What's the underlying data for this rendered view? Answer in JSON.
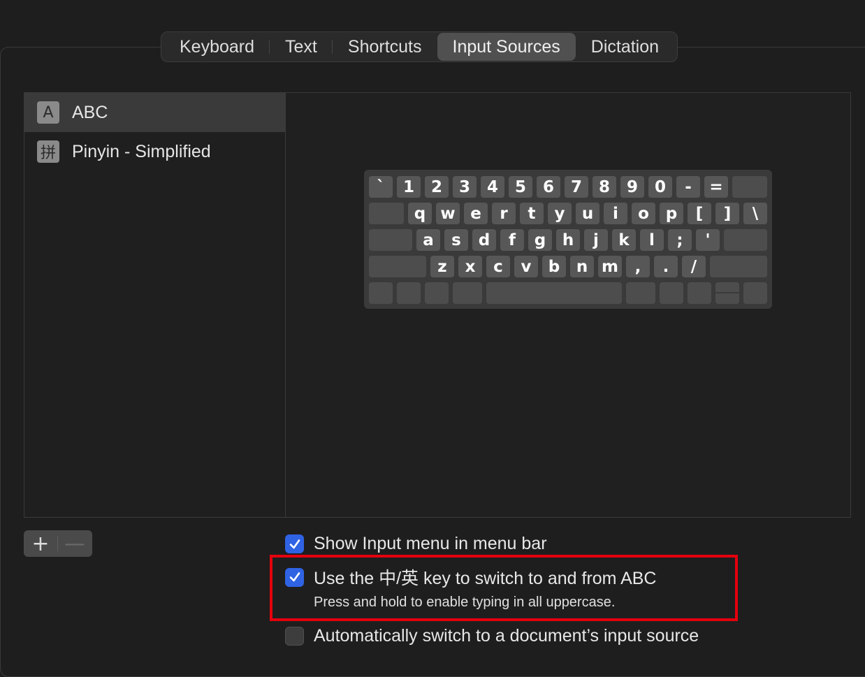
{
  "tabs": [
    "Keyboard",
    "Text",
    "Shortcuts",
    "Input Sources",
    "Dictation"
  ],
  "active_tab": "Input Sources",
  "input_sources": [
    {
      "icon": "A",
      "label": "ABC",
      "selected": true
    },
    {
      "icon": "拼",
      "label": "Pinyin - Simplified",
      "selected": false
    }
  ],
  "keyboard": {
    "row1": [
      "`",
      "1",
      "2",
      "3",
      "4",
      "5",
      "6",
      "7",
      "8",
      "9",
      "0",
      "-",
      "="
    ],
    "row2": [
      "q",
      "w",
      "e",
      "r",
      "t",
      "y",
      "u",
      "i",
      "o",
      "p",
      "[",
      "]",
      "\\"
    ],
    "row3": [
      "a",
      "s",
      "d",
      "f",
      "g",
      "h",
      "j",
      "k",
      "l",
      ";",
      "'"
    ],
    "row4": [
      "z",
      "x",
      "c",
      "v",
      "b",
      "n",
      "m",
      ",",
      ".",
      "/"
    ]
  },
  "buttons": {
    "add": "+",
    "remove": "—"
  },
  "options": {
    "show_input_menu": {
      "label": "Show Input menu in menu bar",
      "checked": true
    },
    "use_key": {
      "label": "Use the 中/英 key to switch to and from ABC",
      "checked": true,
      "sublabel": "Press and hold to enable typing in all uppercase."
    },
    "auto_switch": {
      "label": "Automatically switch to a document’s input source",
      "checked": false
    }
  },
  "colors": {
    "accent": "#2f63e4",
    "highlight": "#e4000e"
  }
}
